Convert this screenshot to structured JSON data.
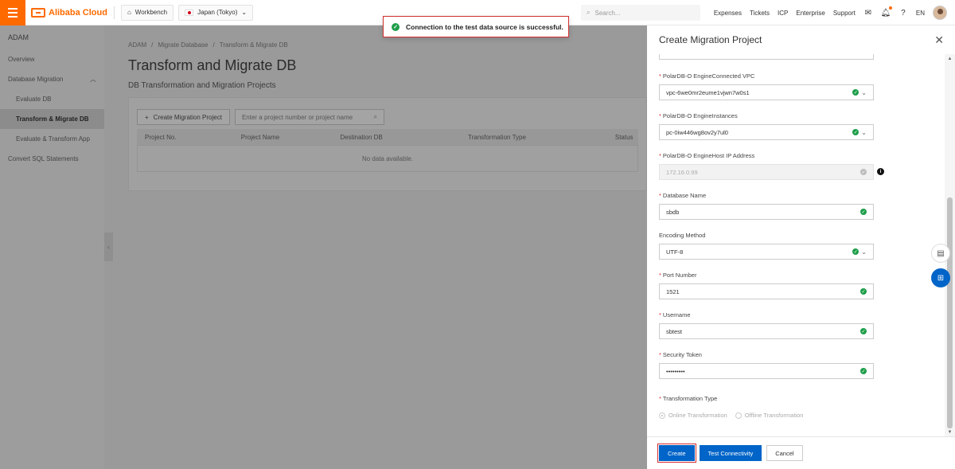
{
  "topbar": {
    "brand": "Alibaba Cloud",
    "workbench": "Workbench",
    "region": "Japan (Tokyo)",
    "search_placeholder": "Search...",
    "links": [
      "Expenses",
      "Tickets",
      "ICP",
      "Enterprise",
      "Support"
    ],
    "lang": "EN",
    "icons": [
      "mail-icon",
      "bell-icon",
      "help-icon"
    ]
  },
  "sidebar": {
    "title": "ADAM",
    "items": [
      {
        "label": "Overview"
      },
      {
        "label": "Database Migration"
      },
      {
        "label": "Evaluate DB"
      },
      {
        "label": "Transform & Migrate DB"
      },
      {
        "label": "Evaluate & Transform App"
      },
      {
        "label": "Convert SQL Statements"
      }
    ]
  },
  "main": {
    "breadcrumb": [
      "ADAM",
      "/",
      "Migrate Database",
      "/",
      "Transform & Migrate DB"
    ],
    "title": "Transform and Migrate DB",
    "section": "DB Transformation and Migration Projects",
    "create_button": "Create Migration Project",
    "filter_placeholder": "Enter a project number or project name",
    "columns": [
      "Project No.",
      "Project Name",
      "Destination DB",
      "Transformation Type",
      "Status"
    ],
    "empty": "No data available."
  },
  "toast": {
    "message": "Connection to the test data source is successful."
  },
  "drawer": {
    "title": "Create Migration Project",
    "fields": [
      {
        "label": "PolarDB-O EngineConnected VPC",
        "value": "vpc-6we0mr2eume1vjwn7w0s1"
      },
      {
        "label": "PolarDB-O EngineInstances",
        "value": "pc-0iw446wg8ov2y7ul0"
      },
      {
        "label": "PolarDB-O EngineHost IP Address",
        "value": "172.16.0.99"
      },
      {
        "label": "Database Name",
        "value": "sbdb"
      },
      {
        "label": "Encoding Method",
        "value": "UTF-8"
      },
      {
        "label": "Port Number",
        "value": "1521"
      },
      {
        "label": "Username",
        "value": "sbtest"
      },
      {
        "label": "Security Token",
        "value": "•••••••••"
      },
      {
        "label": "Transformation Type",
        "value": ""
      }
    ],
    "radio_options": [
      "Online Transformation",
      "Offline Transformation"
    ],
    "buttons": {
      "create": "Create",
      "test": "Test Connectivity",
      "cancel": "Cancel"
    }
  }
}
